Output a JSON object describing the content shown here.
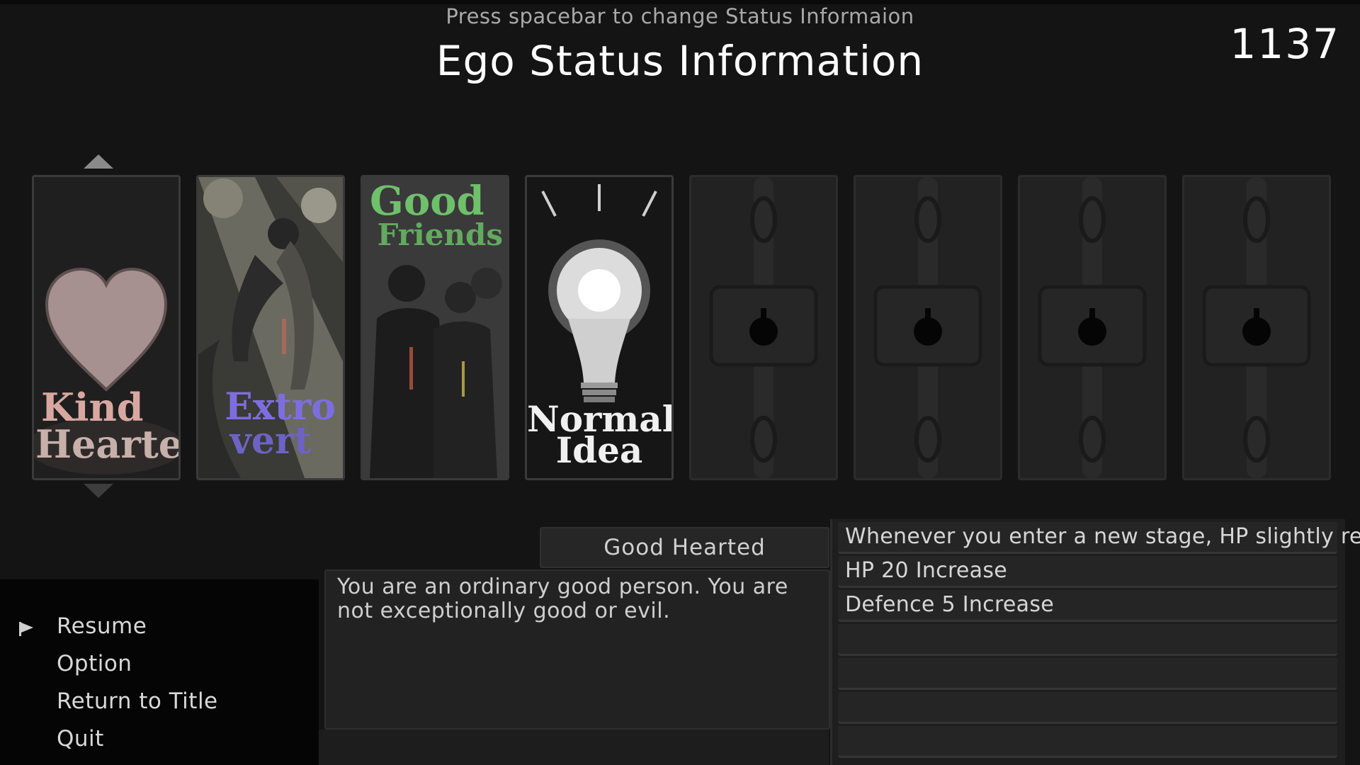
{
  "header": {
    "hint": "Press spacebar to change Status Informaion",
    "title": "Ego Status Information",
    "score": "1137"
  },
  "cards": [
    {
      "label_line1": "Kind",
      "label_line2": "Hearted",
      "icon": "heart-icon",
      "state": "unlocked",
      "selected": true
    },
    {
      "label_line1": "Extro",
      "label_line2": "vert",
      "icon": "dancing-crowd-icon",
      "state": "unlocked"
    },
    {
      "label_line1": "Good",
      "label_line2": "Friends",
      "icon": "friends-group-icon",
      "state": "unlocked"
    },
    {
      "label_line1": "Normal",
      "label_line2": "Idea",
      "icon": "lightbulb-icon",
      "state": "unlocked"
    },
    {
      "icon": "chain-lock-icon",
      "state": "locked"
    },
    {
      "icon": "chain-lock-icon",
      "state": "locked"
    },
    {
      "icon": "chain-lock-icon",
      "state": "locked"
    },
    {
      "icon": "chain-lock-icon",
      "state": "locked"
    }
  ],
  "selected_ego": {
    "name": "Good Hearted",
    "description": "You are an ordinary good person. You are not exceptionally good or evil."
  },
  "effects": [
    "Whenever you enter a new stage, HP slightly recover",
    "HP 20 Increase",
    "Defence 5 Increase",
    "",
    "",
    "",
    ""
  ],
  "menu": {
    "items": [
      "Resume",
      "Option",
      "Return to Title",
      "Quit"
    ],
    "selected_index": 0,
    "cursor_icon": "flag-cursor-icon"
  },
  "colors": {
    "kind_label": "#d8a8a0",
    "extro_label": "#7c6ee0",
    "good_label": "#6fc06a",
    "normal_label": "#f0f0f0",
    "heart": "#a89090"
  }
}
